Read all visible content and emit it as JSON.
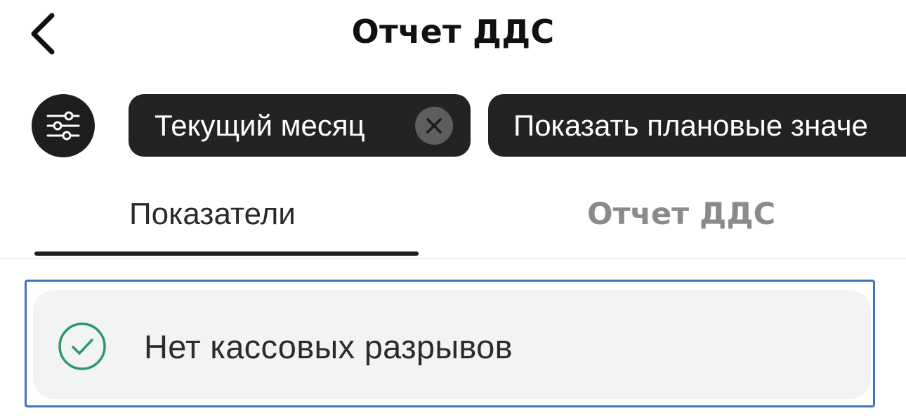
{
  "header": {
    "title": "Отчет ДДС",
    "back_icon": "chevron-left-icon"
  },
  "filters": {
    "filter_icon": "sliders-icon",
    "chips": [
      {
        "label": "Текущий месяц",
        "clear_icon": "close-icon"
      },
      {
        "label": "Показать плановые значе"
      }
    ]
  },
  "tabs": {
    "items": [
      {
        "label": "Показатели",
        "active": true
      },
      {
        "label": "Отчет ДДС",
        "active": false
      }
    ]
  },
  "status": {
    "text": "Нет кассовых разрывов",
    "icon": "check-circle-icon",
    "icon_color": "#2a9a6a"
  },
  "colors": {
    "chip_background": "#232323",
    "focus_border": "#3b76b5",
    "card_background": "#f2f3f5",
    "inactive_tab": "#8a8a8a"
  }
}
